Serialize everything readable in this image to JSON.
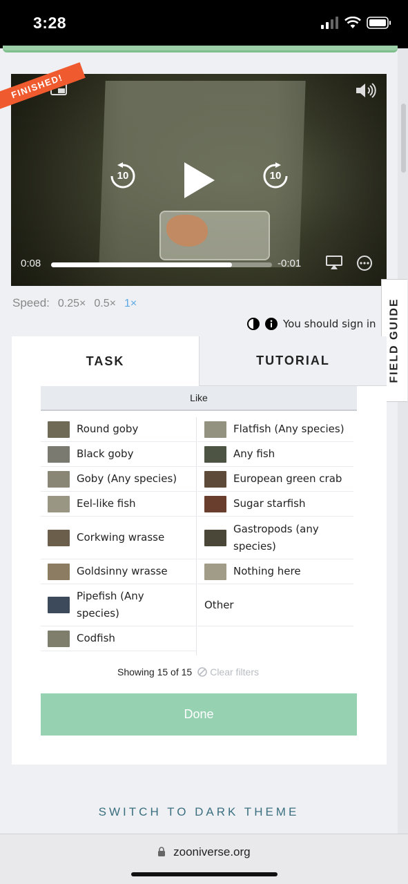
{
  "status_bar": {
    "time": "3:28"
  },
  "video": {
    "badge": "FINISHED!",
    "current_time": "0:08",
    "remaining_time": "-0:01",
    "progress_fraction": 0.82,
    "rewind_label": "10",
    "forward_label": "10"
  },
  "speed": {
    "label": "Speed:",
    "options": [
      "0.25×",
      "0.5×",
      "1×"
    ],
    "selected": "1×"
  },
  "sign_in_notice": "You should sign in",
  "field_guide_label": "FIELD GUIDE",
  "tabs": {
    "task": "TASK",
    "tutorial": "TUTORIAL"
  },
  "filter_label": "Like",
  "species_left": [
    {
      "label": "Round goby",
      "thumb": "#6f6a55"
    },
    {
      "label": "Black goby",
      "thumb": "#7a7a70"
    },
    {
      "label": "Goby (Any species)",
      "thumb": "#8a8676"
    },
    {
      "label": "Eel-like fish",
      "thumb": "#9a9684"
    },
    {
      "label": "Corkwing wrasse",
      "thumb": "#6b5e4a"
    },
    {
      "label": "Goldsinny wrasse",
      "thumb": "#8c7d62"
    },
    {
      "label": "Pipefish (Any species)",
      "thumb": "#3d4a5c"
    },
    {
      "label": "Codfish",
      "thumb": "#7f7e6c"
    }
  ],
  "species_right": [
    {
      "label": "Flatfish (Any species)",
      "thumb": "#93917f"
    },
    {
      "label": "Any fish",
      "thumb": "#4d5444"
    },
    {
      "label": "European green crab",
      "thumb": "#5e4a38"
    },
    {
      "label": "Sugar starfish",
      "thumb": "#6a3e2c"
    },
    {
      "label": "Gastropods (any species)",
      "thumb": "#4a4638"
    },
    {
      "label": "Nothing here",
      "thumb": "#a09c88"
    },
    {
      "label": "Other",
      "thumb": ""
    }
  ],
  "results": {
    "showing": "Showing 15 of 15",
    "clear": "Clear filters"
  },
  "done_label": "Done",
  "switch_theme": "SWITCH TO DARK THEME",
  "url": "zooniverse.org"
}
